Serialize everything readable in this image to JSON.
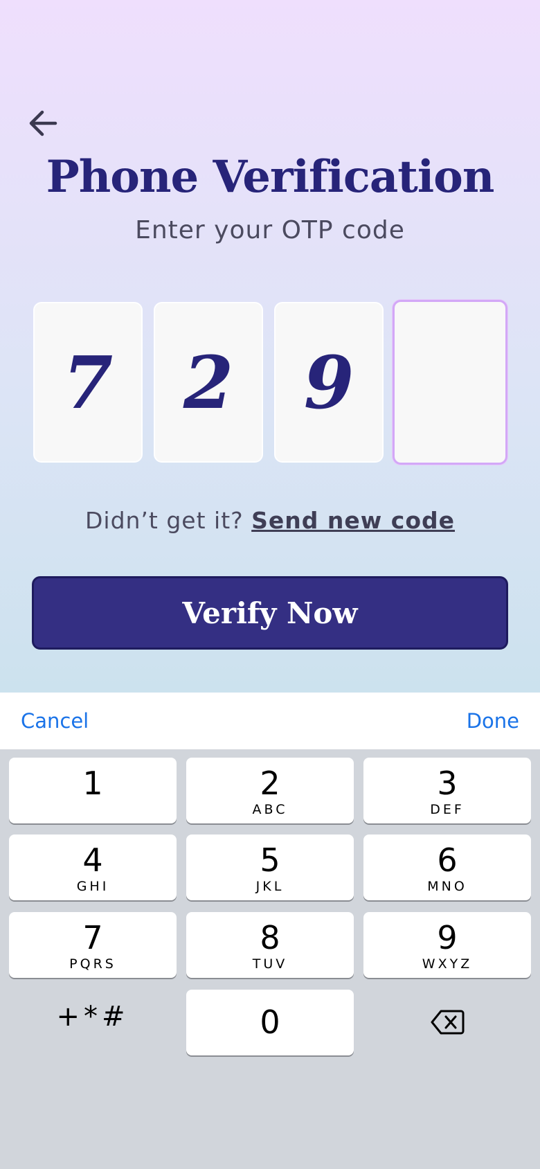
{
  "screen": {
    "title": "Phone Verification",
    "subtitle": "Enter your OTP code"
  },
  "otp": {
    "digits": [
      "7",
      "2",
      "9",
      ""
    ],
    "active_index": 3
  },
  "resend": {
    "prompt": "Didn’t get it?",
    "link": "Send new code"
  },
  "verify_button": {
    "label": "Verify Now"
  },
  "keyboard": {
    "toolbar": {
      "cancel": "Cancel",
      "done": "Done"
    },
    "keys": [
      {
        "num": "1",
        "letters": ""
      },
      {
        "num": "2",
        "letters": "ABC"
      },
      {
        "num": "3",
        "letters": "DEF"
      },
      {
        "num": "4",
        "letters": "GHI"
      },
      {
        "num": "5",
        "letters": "JKL"
      },
      {
        "num": "6",
        "letters": "MNO"
      },
      {
        "num": "7",
        "letters": "PQRS"
      },
      {
        "num": "8",
        "letters": "TUV"
      },
      {
        "num": "9",
        "letters": "WXYZ"
      },
      {
        "num": "0",
        "letters": ""
      }
    ],
    "symbols_key": "+*#"
  },
  "icons": {
    "back": "arrow-left-icon",
    "delete": "backspace-icon"
  },
  "colors": {
    "primary": "#342f83",
    "heading": "#272479",
    "link": "#1a73e8",
    "active_border": "#d3a8f7"
  }
}
